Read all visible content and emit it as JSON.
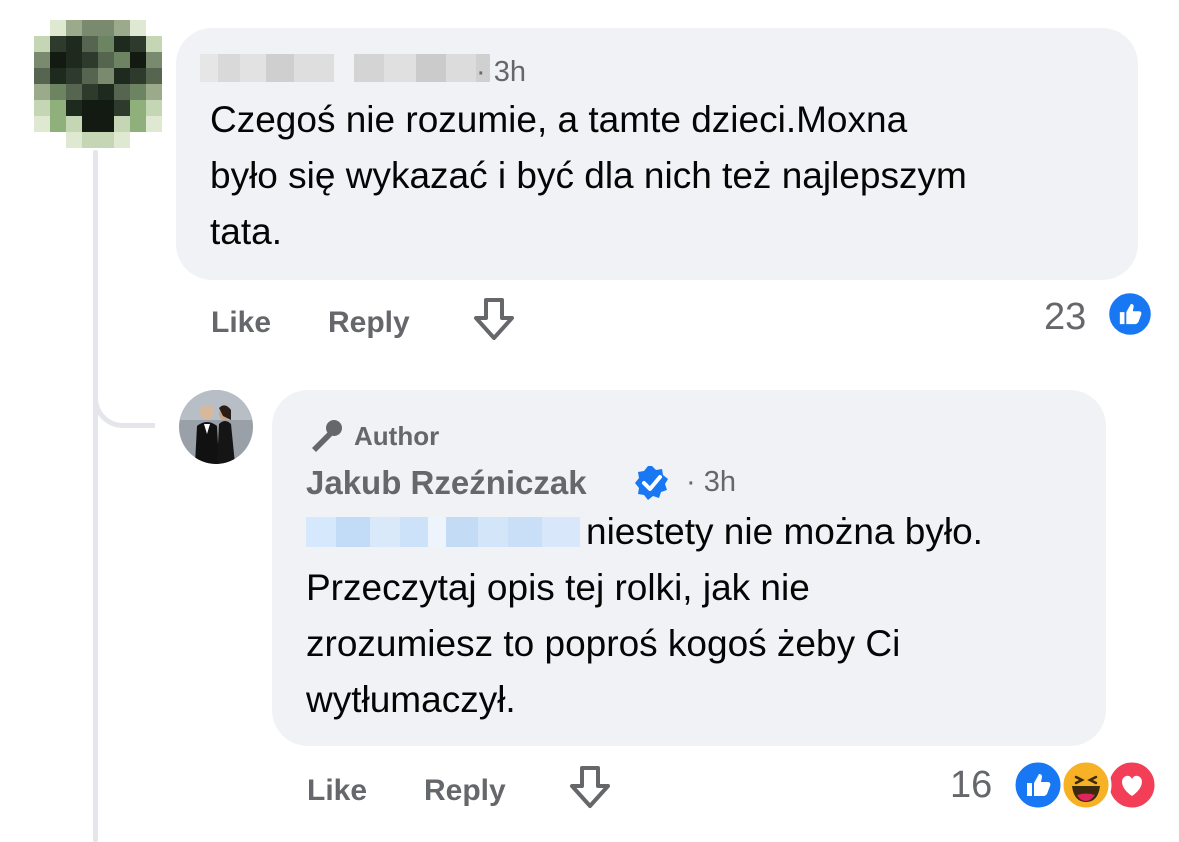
{
  "comment1": {
    "time": "· 3h",
    "text_lines": [
      "Czegoś nie rozumie, a tamte dzieci.Moxna",
      "było się wykazać i być dla nich też najlepszym",
      "tata."
    ],
    "actions": {
      "like": "Like",
      "reply": "Reply"
    },
    "reaction_count": "23",
    "reactions": [
      "like-icon"
    ]
  },
  "comment2": {
    "badge": "Author",
    "author_name": "Jakub Rzeźniczak",
    "time": "· 3h",
    "text_line1_after_mention": "niestety nie można było.",
    "text_lines": [
      "Przeczytaj opis tej rolki, jak nie",
      "zrozumiesz to poproś kogoś żeby Ci",
      "wytłumaczył."
    ],
    "actions": {
      "like": "Like",
      "reply": "Reply"
    },
    "reaction_count": "16",
    "reactions": [
      "like-icon",
      "haha-icon",
      "love-icon"
    ]
  },
  "colors": {
    "like_blue": "#1877f2",
    "bubble": "#f0f2f5",
    "muted": "#65676b",
    "love": "#f33e58",
    "haha": "#f7b125"
  }
}
